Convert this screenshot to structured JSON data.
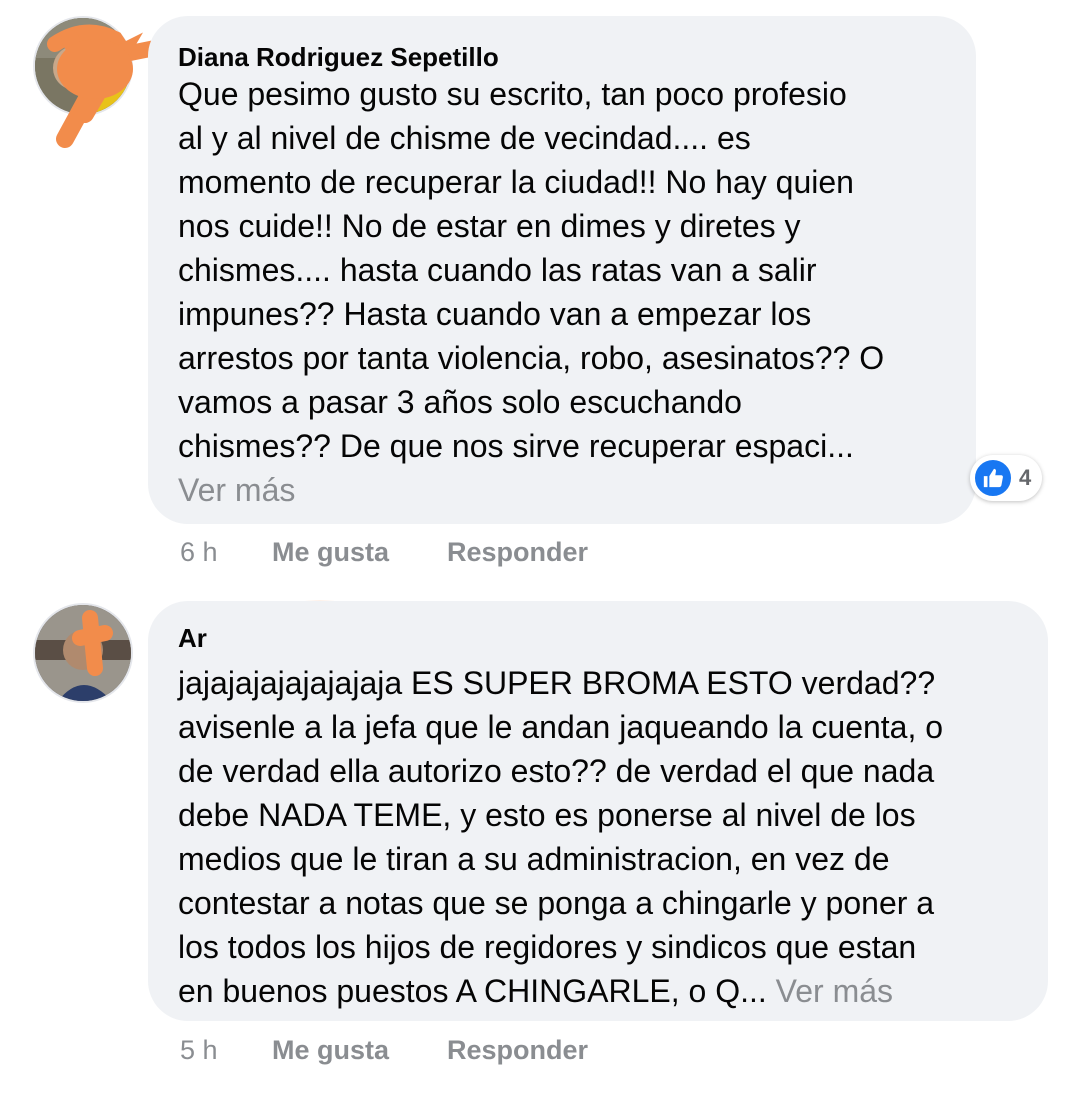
{
  "comments": [
    {
      "author": "Diana Rodriguez Sepetillo",
      "lines": [
        "Que pesimo gusto su escrito, tan poco profesio",
        "al y al nivel de chisme de vecindad.... es",
        "momento de recuperar la ciudad!! No hay quien",
        "nos cuide!! No de estar en dimes y diretes y",
        "chismes.... hasta cuando las ratas van a salir",
        "impunes?? Hasta cuando van a empezar los",
        "arrestos por tanta violencia, robo, asesinatos?? O",
        "vamos a pasar 3 años solo escuchando",
        "chismes?? De que nos sirve recuperar espaci..."
      ],
      "see_more": "Ver más",
      "reaction_count": "4",
      "time": "6 h",
      "like_label": "Me gusta",
      "reply_label": "Responder"
    },
    {
      "author": "Ar",
      "lines": [
        "jajajajajajajajaja ES SUPER BROMA ESTO verdad??",
        "avisenle a la jefa que le andan jaqueando la cuenta, o",
        "de verdad ella autorizo esto?? de verdad el que nada",
        "debe NADA TEME, y esto es ponerse al nivel de los",
        "medios que le tiran a su administracion, en vez de",
        "contestar a notas que se ponga a chingarle y poner a",
        "los todos los hijos de regidores y sindicos que estan"
      ],
      "last_line": "en buenos puestos A CHINGARLE, o Q...",
      "see_more": "Ver más",
      "time": "5 h",
      "like_label": "Me gusta",
      "reply_label": "Responder"
    }
  ],
  "colors": {
    "bubble": "#f0f2f5",
    "meta_text": "#8a8d91",
    "like_blue": "#1877f2",
    "redaction": "#f28c4b"
  }
}
